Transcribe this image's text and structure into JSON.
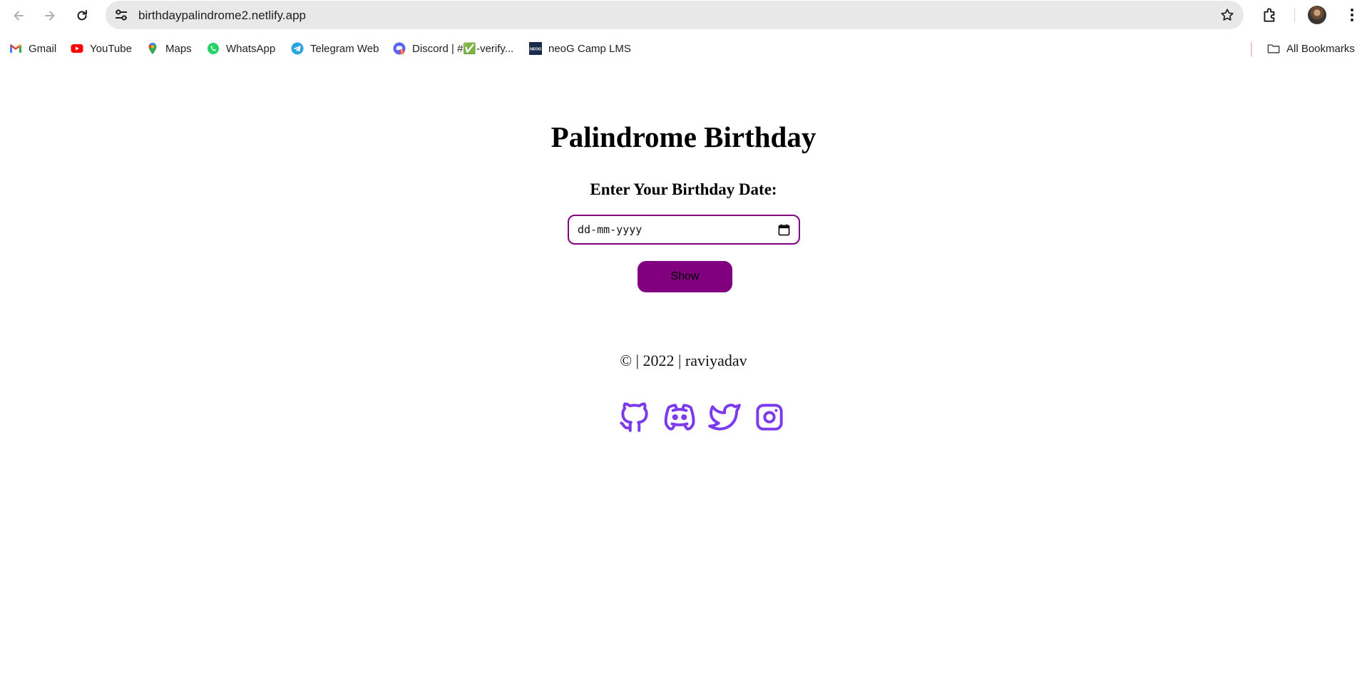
{
  "browser": {
    "url": "birthdaypalindrome2.netlify.app",
    "icons": {
      "back": "arrow-left-icon",
      "forward": "arrow-right-icon",
      "reload": "reload-icon",
      "site_info": "tune-icon",
      "bookmark_star": "star-icon",
      "extensions": "puzzle-icon",
      "profile": "avatar",
      "menu": "kebab-menu-icon"
    }
  },
  "bookmarks": {
    "items": [
      {
        "label": "Gmail",
        "icon": "gmail-icon"
      },
      {
        "label": "YouTube",
        "icon": "youtube-icon"
      },
      {
        "label": "Maps",
        "icon": "maps-icon"
      },
      {
        "label": "WhatsApp",
        "icon": "whatsapp-icon"
      },
      {
        "label": "Telegram Web",
        "icon": "telegram-icon"
      },
      {
        "label": "Discord | #✅-verify...",
        "icon": "discord-icon"
      },
      {
        "label": "neoG Camp LMS",
        "icon": "neog-icon"
      }
    ],
    "all_bookmarks": {
      "label": "All Bookmarks",
      "icon": "folder-icon"
    }
  },
  "page": {
    "title": "Palindrome Birthday",
    "date_label": "Enter Your Birthday Date:",
    "date_input": {
      "placeholder": "dd-mm-yyyy",
      "icon": "calendar-icon"
    },
    "show_button": "Show",
    "footer": "© | 2022 | raviyadav",
    "social": [
      "github-icon",
      "discord-icon",
      "twitter-icon",
      "instagram-icon"
    ]
  },
  "colors": {
    "accent": "#800080",
    "social_icons": "#7c3aed",
    "omnibox": "#e8e8e8"
  }
}
